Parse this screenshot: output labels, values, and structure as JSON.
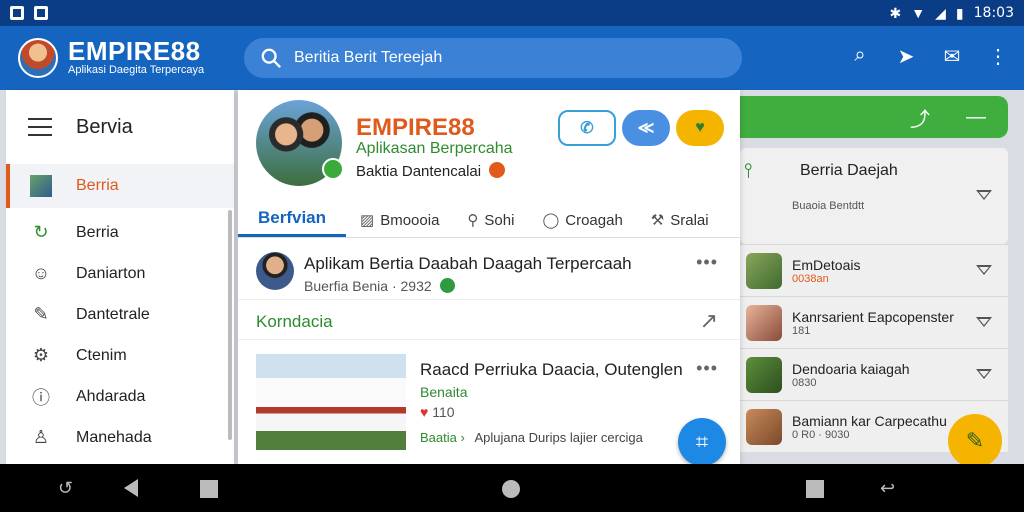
{
  "status": {
    "time": "18:03"
  },
  "appbar": {
    "brand_name": "EMPIRE88",
    "brand_tagline": "Aplikasi Daegita Terpercaya",
    "search_text": "Beritia Berit Tereejah"
  },
  "sidebar": {
    "title": "Bervia",
    "items": [
      {
        "label": "Berria",
        "icon": "image-icon"
      },
      {
        "label": "Berria",
        "icon": "refresh-icon"
      },
      {
        "label": "Daniarton",
        "icon": "people-icon"
      },
      {
        "label": "Dantetrale",
        "icon": "edit-icon"
      },
      {
        "label": "Ctenim",
        "icon": "settings-icon"
      },
      {
        "label": "Ahdarada",
        "icon": "info-icon"
      },
      {
        "label": "Manehada",
        "icon": "person-icon"
      }
    ]
  },
  "profile": {
    "title": "EMPIRE88",
    "subtitle": "Aplikasan Berpercaha",
    "meta": "Baktia Dantencalai"
  },
  "tabs": [
    {
      "label": "Berfvian"
    },
    {
      "label": "Bmoooia"
    },
    {
      "label": "Sohi"
    },
    {
      "label": "Croagah"
    },
    {
      "label": "Sralai"
    }
  ],
  "post": {
    "title": "Aplikam Bertia Daabah Daagah Terpercaah",
    "meta": "Buerfia Benia · 2932"
  },
  "section": {
    "label": "Korndacia"
  },
  "article": {
    "title": "Raacd Perriuka Daacia, Outenglen",
    "source": "Benaita",
    "count": "110",
    "link": "Baatia",
    "link_extra": "Aplujana Durips lajier cerciga"
  },
  "right_list": {
    "header_title": "Berria Daejah",
    "header_sub": "Buaoia Bentdtt",
    "rows": [
      {
        "title": "EmDetoais",
        "sub": "0038an"
      },
      {
        "title": "Kanrsarient Eapcopenster",
        "sub": "181"
      },
      {
        "title": "Dendoaria kaiagah",
        "sub": "0830"
      },
      {
        "title": "Bamiann kar Carpecathu",
        "sub": "0 R0 · 9030"
      }
    ]
  },
  "colors": {
    "appbar": "#1565c0",
    "accent": "#e05a1b",
    "green": "#2e8b2e"
  }
}
